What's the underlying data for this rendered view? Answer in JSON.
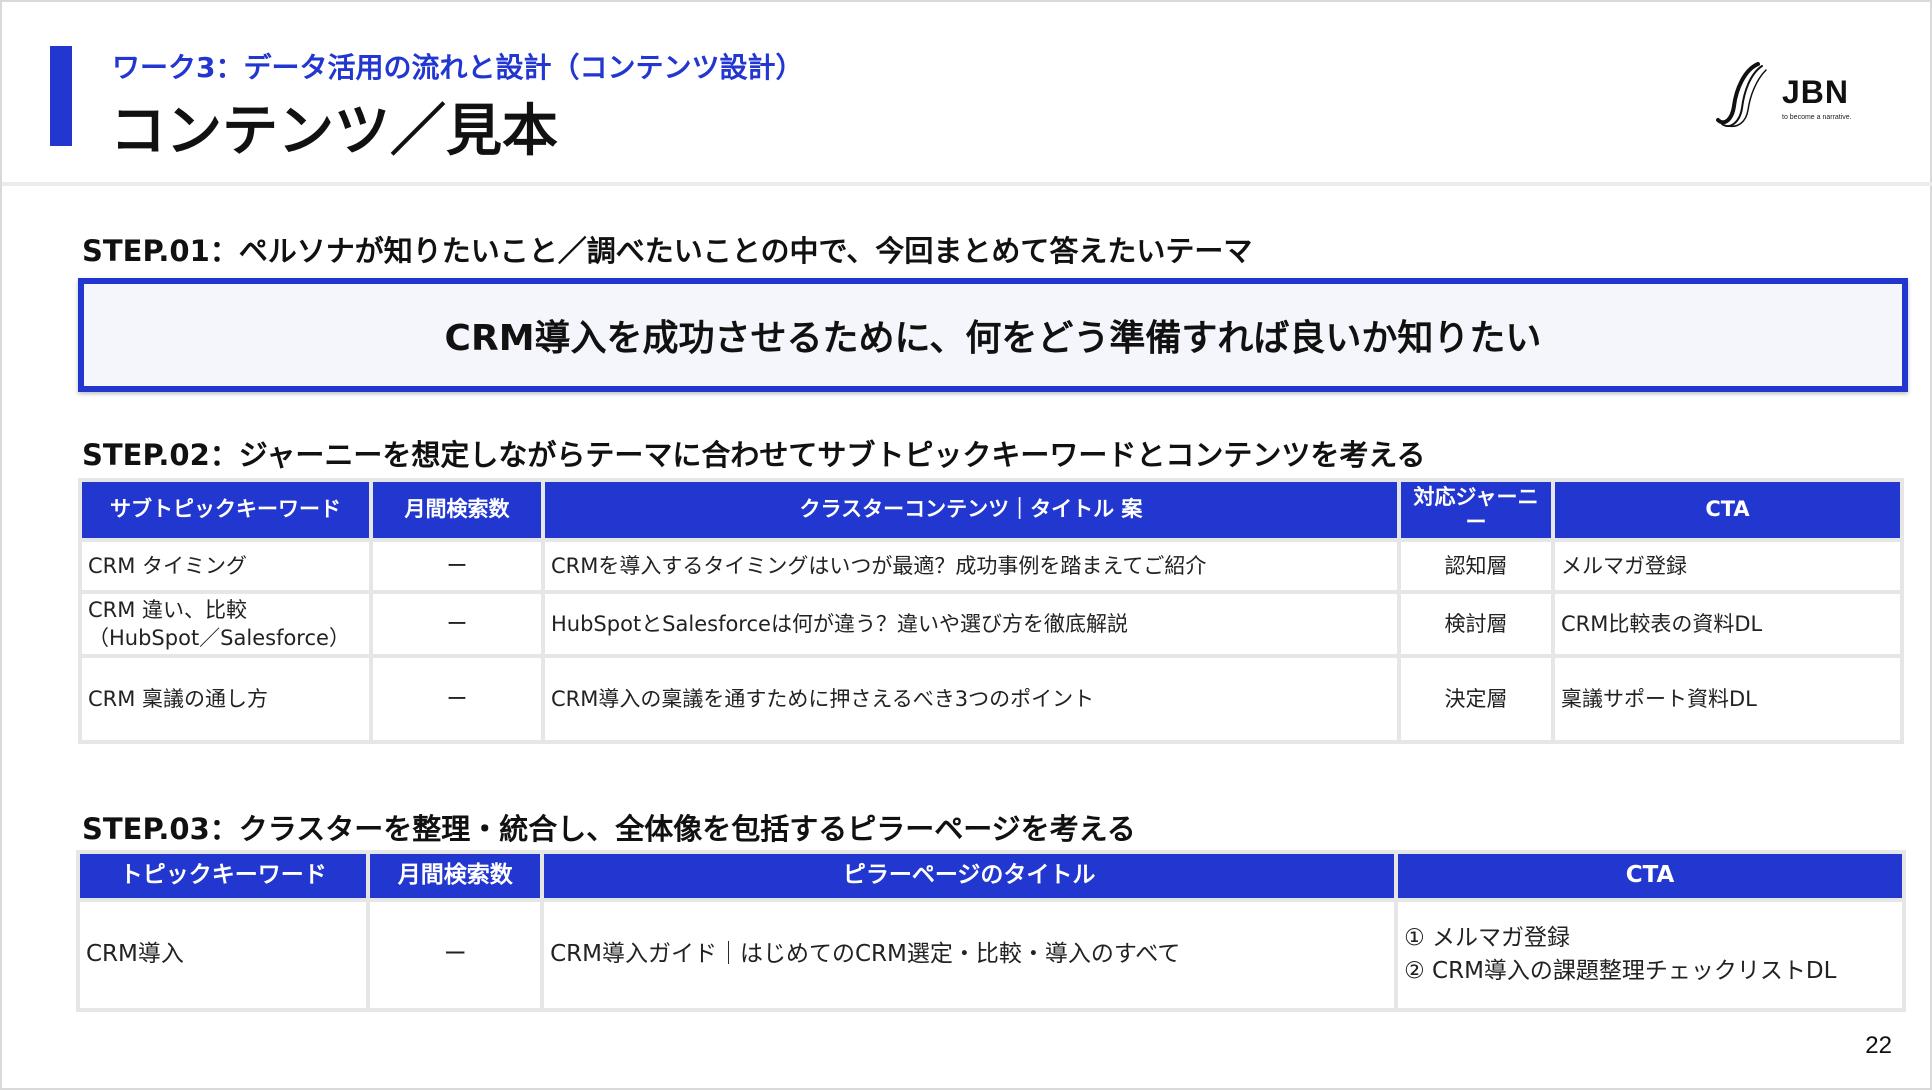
{
  "header": {
    "subtitle": "ワーク3：データ活用の流れと設計（コンテンツ設計）",
    "title": "コンテンツ／見本"
  },
  "logo": {
    "name": "JBN",
    "tagline": "to become a narrative.",
    "icon": "jbn-logo-mark"
  },
  "step1": {
    "label": "STEP.01：ペルソナが知りたいこと／調べたいことの中で、今回まとめて答えたいテーマ",
    "theme": "CRM導入を成功させるために、何をどう準備すれば良いか知りたい"
  },
  "step2": {
    "label": "STEP.02：ジャーニーを想定しながらテーマに合わせてサブトピックキーワードとコンテンツを考える",
    "headers": [
      "サブトピックキーワード",
      "月間検索数",
      "クラスターコンテンツ｜タイトル 案",
      "対応ジャーニー",
      "CTA"
    ],
    "rows": [
      {
        "keyword": "CRM タイミング",
        "keyword2": "",
        "volume": "ー",
        "title": "CRMを導入するタイミングはいつが最適？成功事例を踏まえてご紹介",
        "journey": "認知層",
        "cta": "メルマガ登録"
      },
      {
        "keyword": "CRM 違い、比較",
        "keyword2": "（HubSpot／Salesforce）",
        "volume": "ー",
        "title": "HubSpotとSalesforceは何が違う？違いや選び方を徹底解説",
        "journey": "検討層",
        "cta": "CRM比較表の資料DL"
      },
      {
        "keyword": "CRM 稟議の通し方",
        "keyword2": "",
        "volume": "ー",
        "title": "CRM導入の稟議を通すために押さえるべき3つのポイント",
        "journey": "決定層",
        "cta": "稟議サポート資料DL"
      }
    ]
  },
  "step3": {
    "label": "STEP.03：クラスターを整理・統合し、全体像を包括するピラーページを考える",
    "headers": [
      "トピックキーワード",
      "月間検索数",
      "ピラーページのタイトル",
      "CTA"
    ],
    "row": {
      "keyword": "CRM導入",
      "volume": "ー",
      "title": "CRM導入ガイド｜はじめてのCRM選定・比較・導入のすべて",
      "cta1": "① メルマガ登録",
      "cta2": "② CRM導入の課題整理チェックリストDL"
    }
  },
  "page_number": "22",
  "colors": {
    "accent": "#2236d0",
    "header_text": "#ffffff",
    "theme_bg": "#f5f6fb"
  }
}
